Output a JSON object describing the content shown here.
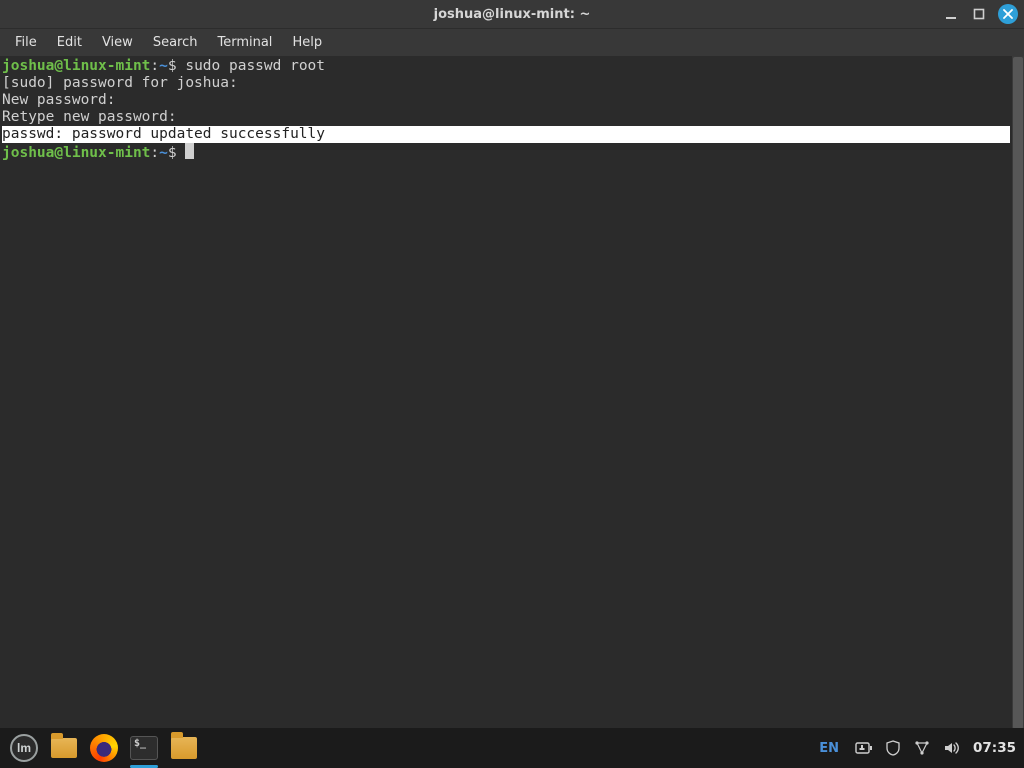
{
  "window": {
    "title": "joshua@linux-mint: ~",
    "menus": [
      "File",
      "Edit",
      "View",
      "Search",
      "Terminal",
      "Help"
    ]
  },
  "prompt": {
    "user_host": "joshua@linux-mint",
    "sep": ":",
    "path": "~",
    "symbol": "$"
  },
  "terminal": {
    "cmd1": "sudo passwd root",
    "line_sudo": "[sudo] password for joshua: ",
    "line_new": "New password: ",
    "line_retype": "Retype new password: ",
    "line_success": "passwd: password updated successfully"
  },
  "taskbar": {
    "lang": "EN",
    "clock": "07:35"
  }
}
